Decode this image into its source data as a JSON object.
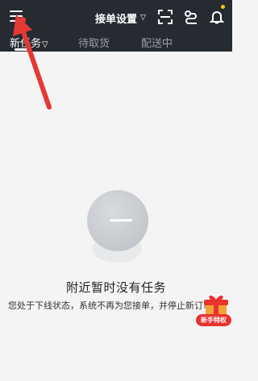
{
  "header": {
    "menu_icon": "hamburger-menu-icon",
    "settings_label": "接单设置",
    "icons": [
      "scan-icon",
      "route-icon",
      "bell-icon"
    ]
  },
  "tabs": [
    {
      "label": "新任务",
      "active": true
    },
    {
      "label": "待取货",
      "active": false
    },
    {
      "label": "配送中",
      "active": false
    }
  ],
  "empty": {
    "title": "附近暂时没有任务",
    "description": "您处于下线状态，系统不再为您接单，并停止新订单推送"
  },
  "promo": {
    "label": "新手特权"
  },
  "colors": {
    "header_bg": "#262a31",
    "annotation_arrow": "#e53935",
    "promo_red": "#e8332f"
  }
}
